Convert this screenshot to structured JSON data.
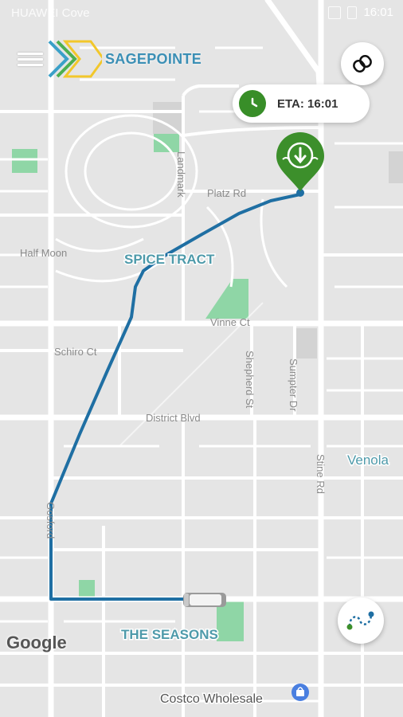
{
  "status_bar": {
    "carrier": "HUAWEI Cove",
    "time": "16:01"
  },
  "header": {
    "brand": "SAGEPOINTE"
  },
  "eta": {
    "label": "ETA: 16:01"
  },
  "map": {
    "watermark": "Google",
    "places": {
      "spice_tract": "SPICE TRACT",
      "the_seasons": "THE SEASONS",
      "venola": "Venola",
      "costco": "Costco Wholesale"
    },
    "streets": {
      "platz_rd": "Platz Rd",
      "half_moon": "Half Moon",
      "vinne_ct": "Vinne Ct",
      "schiro_ct": "Schiro Ct",
      "district_blvd": "District Blvd",
      "stine_rd": "Stine Rd",
      "gosford": "Gosford",
      "shepherd_st": "Shepherd St",
      "sumpter_dr": "Sumpter Dr",
      "landmark": "Landmark"
    }
  },
  "colors": {
    "route": "#1f6fa3",
    "pin": "#3c8f2b",
    "eta_icon": "#388e28",
    "park": "#8fd6a6",
    "road": "#ffffff",
    "land": "#e5e5e5",
    "label_teal": "#4e9aaa"
  },
  "icons": {
    "menu": "hamburger-menu-icon",
    "link": "linked-rings-icon",
    "clock": "clock-icon",
    "pin": "location-pin-icon",
    "route": "route-icon",
    "vehicle": "vehicle-icon"
  }
}
